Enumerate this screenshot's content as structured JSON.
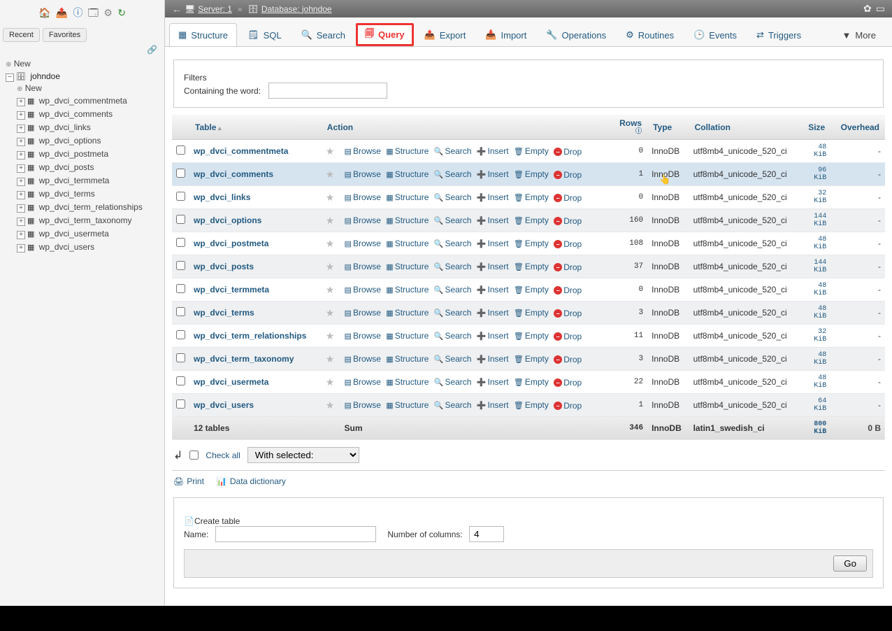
{
  "sidebar": {
    "tabs": {
      "recent": "Recent",
      "favorites": "Favorites"
    },
    "newLabel": "New",
    "db": "johndoe",
    "newTableLabel": "New",
    "tables": [
      "wp_dvci_commentmeta",
      "wp_dvci_comments",
      "wp_dvci_links",
      "wp_dvci_options",
      "wp_dvci_postmeta",
      "wp_dvci_posts",
      "wp_dvci_termmeta",
      "wp_dvci_terms",
      "wp_dvci_term_relationships",
      "wp_dvci_term_taxonomy",
      "wp_dvci_usermeta",
      "wp_dvci_users"
    ]
  },
  "breadcrumb": {
    "serverLabel": "Server: 1",
    "dbLabel": "Database: johndoe"
  },
  "tabs": {
    "structure": "Structure",
    "sql": "SQL",
    "search": "Search",
    "query": "Query",
    "export": "Export",
    "import": "Import",
    "operations": "Operations",
    "routines": "Routines",
    "events": "Events",
    "triggers": "Triggers",
    "more": "More"
  },
  "filters": {
    "legend": "Filters",
    "label": "Containing the word:",
    "value": ""
  },
  "thead": {
    "table": "Table",
    "action": "Action",
    "rows": "Rows",
    "type": "Type",
    "collation": "Collation",
    "size": "Size",
    "overhead": "Overhead"
  },
  "actions": {
    "browse": "Browse",
    "structure": "Structure",
    "search": "Search",
    "insert": "Insert",
    "empty": "Empty",
    "drop": "Drop"
  },
  "rows": [
    {
      "name": "wp_dvci_commentmeta",
      "rows": 0,
      "type": "InnoDB",
      "coll": "utf8mb4_unicode_520_ci",
      "size": "48",
      "unit": "KiB",
      "ov": "-"
    },
    {
      "name": "wp_dvci_comments",
      "rows": 1,
      "type": "InnoDB",
      "coll": "utf8mb4_unicode_520_ci",
      "size": "96",
      "unit": "KiB",
      "ov": "-",
      "hover": true
    },
    {
      "name": "wp_dvci_links",
      "rows": 0,
      "type": "InnoDB",
      "coll": "utf8mb4_unicode_520_ci",
      "size": "32",
      "unit": "KiB",
      "ov": "-"
    },
    {
      "name": "wp_dvci_options",
      "rows": 160,
      "type": "InnoDB",
      "coll": "utf8mb4_unicode_520_ci",
      "size": "144",
      "unit": "KiB",
      "ov": "-"
    },
    {
      "name": "wp_dvci_postmeta",
      "rows": 108,
      "type": "InnoDB",
      "coll": "utf8mb4_unicode_520_ci",
      "size": "48",
      "unit": "KiB",
      "ov": "-"
    },
    {
      "name": "wp_dvci_posts",
      "rows": 37,
      "type": "InnoDB",
      "coll": "utf8mb4_unicode_520_ci",
      "size": "144",
      "unit": "KiB",
      "ov": "-"
    },
    {
      "name": "wp_dvci_termmeta",
      "rows": 0,
      "type": "InnoDB",
      "coll": "utf8mb4_unicode_520_ci",
      "size": "48",
      "unit": "KiB",
      "ov": "-"
    },
    {
      "name": "wp_dvci_terms",
      "rows": 3,
      "type": "InnoDB",
      "coll": "utf8mb4_unicode_520_ci",
      "size": "48",
      "unit": "KiB",
      "ov": "-"
    },
    {
      "name": "wp_dvci_term_relationships",
      "rows": 11,
      "type": "InnoDB",
      "coll": "utf8mb4_unicode_520_ci",
      "size": "32",
      "unit": "KiB",
      "ov": "-"
    },
    {
      "name": "wp_dvci_term_taxonomy",
      "rows": 3,
      "type": "InnoDB",
      "coll": "utf8mb4_unicode_520_ci",
      "size": "48",
      "unit": "KiB",
      "ov": "-"
    },
    {
      "name": "wp_dvci_usermeta",
      "rows": 22,
      "type": "InnoDB",
      "coll": "utf8mb4_unicode_520_ci",
      "size": "48",
      "unit": "KiB",
      "ov": "-"
    },
    {
      "name": "wp_dvci_users",
      "rows": 1,
      "type": "InnoDB",
      "coll": "utf8mb4_unicode_520_ci",
      "size": "64",
      "unit": "KiB",
      "ov": "-"
    }
  ],
  "sum": {
    "label": "12 tables",
    "sumlabel": "Sum",
    "rows": 346,
    "type": "InnoDB",
    "coll": "latin1_swedish_ci",
    "size": "800",
    "unit": "KiB",
    "ov": "0 B"
  },
  "below": {
    "checkall": "Check all",
    "withselected": "With selected:"
  },
  "printrow": {
    "print": "Print",
    "dict": "Data dictionary"
  },
  "create": {
    "legend": "Create table",
    "name": "Name:",
    "cols": "Number of columns:",
    "colsval": "4",
    "go": "Go"
  }
}
